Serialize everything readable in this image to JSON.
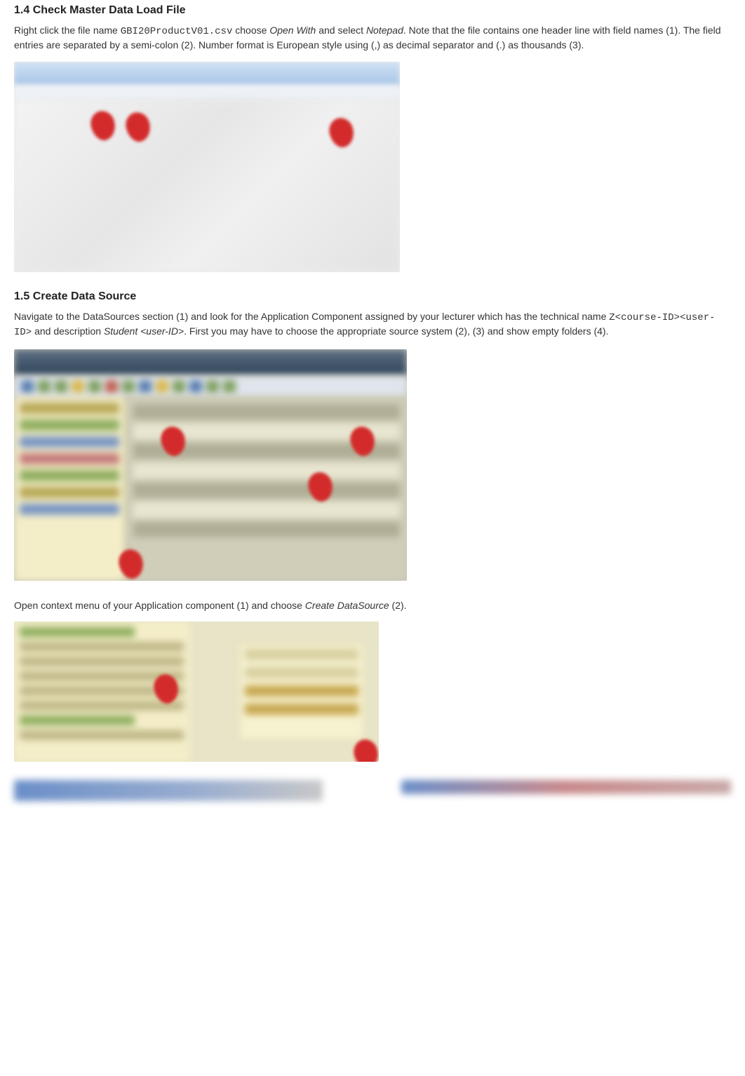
{
  "section14": {
    "heading": "1.4 Check Master Data Load File",
    "p1_a": "Right click the file name ",
    "p1_code": "GBI20ProductV01.csv",
    "p1_b": " choose ",
    "p1_i1": "Open With",
    "p1_c": " and select ",
    "p1_i2": "Notepad",
    "p1_d": ". Note that the file contains one header line with field names (1). The field entries are separated by a semi-colon (2). Number format is European style using (,) as decimal separator and (.) as thousands (3)."
  },
  "section15": {
    "heading": "1.5 Create Data Source",
    "p1_a": "Navigate to the DataSources section (1) and look for the Application Component assigned by your lecturer which has the technical name ",
    "p1_code": "Z<course-ID><user-ID>",
    "p1_b": " and description ",
    "p1_i1": "Student <user-ID>",
    "p1_c": ". First you may have to choose the appropriate source system (2), (3) and show empty folders (4).",
    "p2_a": "Open context menu of your Application component (1) and choose ",
    "p2_i1": "Create DataSource",
    "p2_b": " (2)."
  }
}
